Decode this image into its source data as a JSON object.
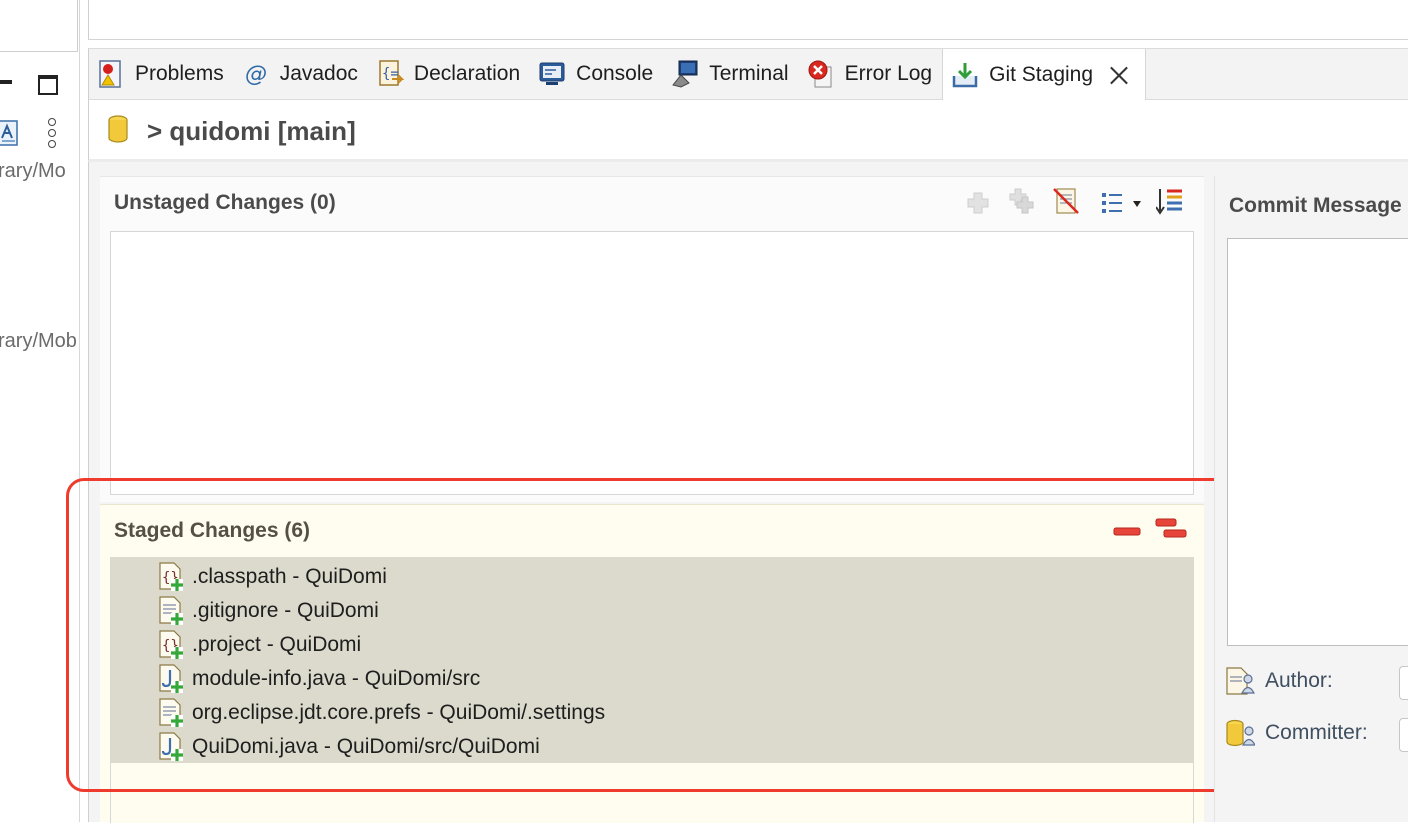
{
  "left_panel": {
    "path_text_1": "rary/Mo",
    "path_text_2": "rary/Mob"
  },
  "tabs": [
    {
      "label": "Problems",
      "icon": "problems-icon"
    },
    {
      "label": "Javadoc",
      "icon": "at-sign-icon"
    },
    {
      "label": "Declaration",
      "icon": "declaration-icon"
    },
    {
      "label": "Console",
      "icon": "console-icon"
    },
    {
      "label": "Terminal",
      "icon": "terminal-icon"
    },
    {
      "label": "Error Log",
      "icon": "error-log-icon"
    },
    {
      "label": "Git Staging",
      "icon": "git-staging-icon",
      "active": true
    }
  ],
  "repo": {
    "title": "> quidomi [main]"
  },
  "unstaged": {
    "title": "Unstaged Changes (0)",
    "items": []
  },
  "staged": {
    "title": "Staged Changes (6)",
    "items": [
      {
        "label": ".classpath - QuiDomi",
        "icon": "xml-file-added-icon"
      },
      {
        "label": ".gitignore - QuiDomi",
        "icon": "text-file-added-icon"
      },
      {
        "label": ".project - QuiDomi",
        "icon": "xml-file-added-icon"
      },
      {
        "label": "module-info.java - QuiDomi/src",
        "icon": "java-file-added-icon"
      },
      {
        "label": "org.eclipse.jdt.core.prefs - QuiDomi/.settings",
        "icon": "text-file-added-icon"
      },
      {
        "label": "QuiDomi.java - QuiDomi/src/QuiDomi",
        "icon": "java-file-added-icon"
      }
    ]
  },
  "commit": {
    "title": "Commit Message",
    "author_label": "Author:",
    "committer_label": "Committer:"
  },
  "colors": {
    "highlight": "#ef3b2d",
    "staged_bg": "#fefdf0",
    "staged_list_bg": "#dcdacc",
    "tab_bar_bg": "#f3f3f3"
  }
}
